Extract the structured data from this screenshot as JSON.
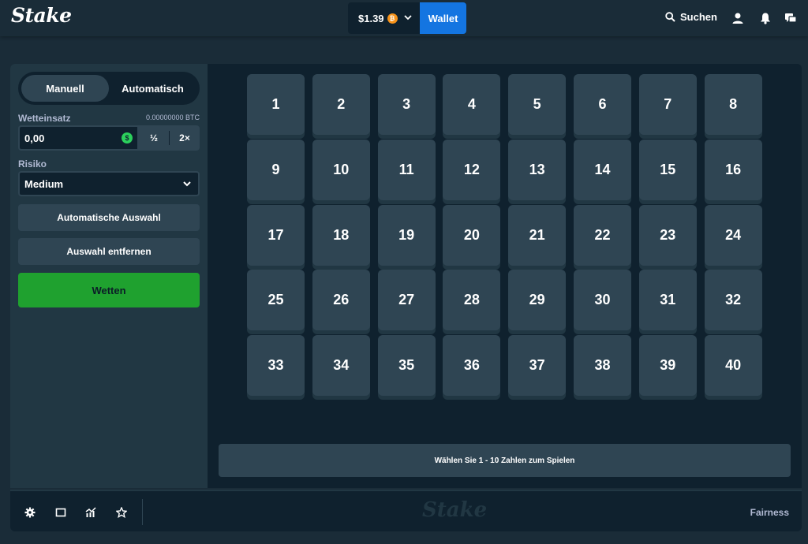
{
  "header": {
    "logo": "Stake",
    "balance": "$1.39",
    "coin_symbol": "₿",
    "wallet_label": "Wallet",
    "search_label": "Suchen"
  },
  "sidebar": {
    "modes": [
      "Manuell",
      "Automatisch"
    ],
    "active_mode": "Manuell",
    "bet_label": "Wetteinsatz",
    "bet_btc": "0.00000000 BTC",
    "bet_value": "0,00",
    "currency_symbol": "$",
    "half_label": "½",
    "double_label": "2×",
    "risk_label": "Risiko",
    "risk_value": "Medium",
    "auto_pick_label": "Automatische Auswahl",
    "clear_label": "Auswahl entfernen",
    "bet_button_label": "Wetten"
  },
  "board": {
    "numbers": [
      "1",
      "2",
      "3",
      "4",
      "5",
      "6",
      "7",
      "8",
      "9",
      "10",
      "11",
      "12",
      "13",
      "14",
      "15",
      "16",
      "17",
      "18",
      "19",
      "20",
      "21",
      "22",
      "23",
      "24",
      "25",
      "26",
      "27",
      "28",
      "29",
      "30",
      "31",
      "32",
      "33",
      "34",
      "35",
      "36",
      "37",
      "38",
      "39",
      "40"
    ],
    "hint": "Wählen Sie 1 - 10 Zahlen zum Spielen"
  },
  "footer": {
    "icons": [
      "settings-icon",
      "theatre-mode-icon",
      "stats-icon",
      "favorite-icon"
    ],
    "logo": "Stake",
    "fairness_label": "Fairness"
  },
  "colors": {
    "background": "#1a2c38",
    "panel": "#0f212e",
    "sidebar": "#213743",
    "tile": "#2f4553",
    "wallet_blue": "#1475e1",
    "bet_green": "#1fa12f"
  }
}
